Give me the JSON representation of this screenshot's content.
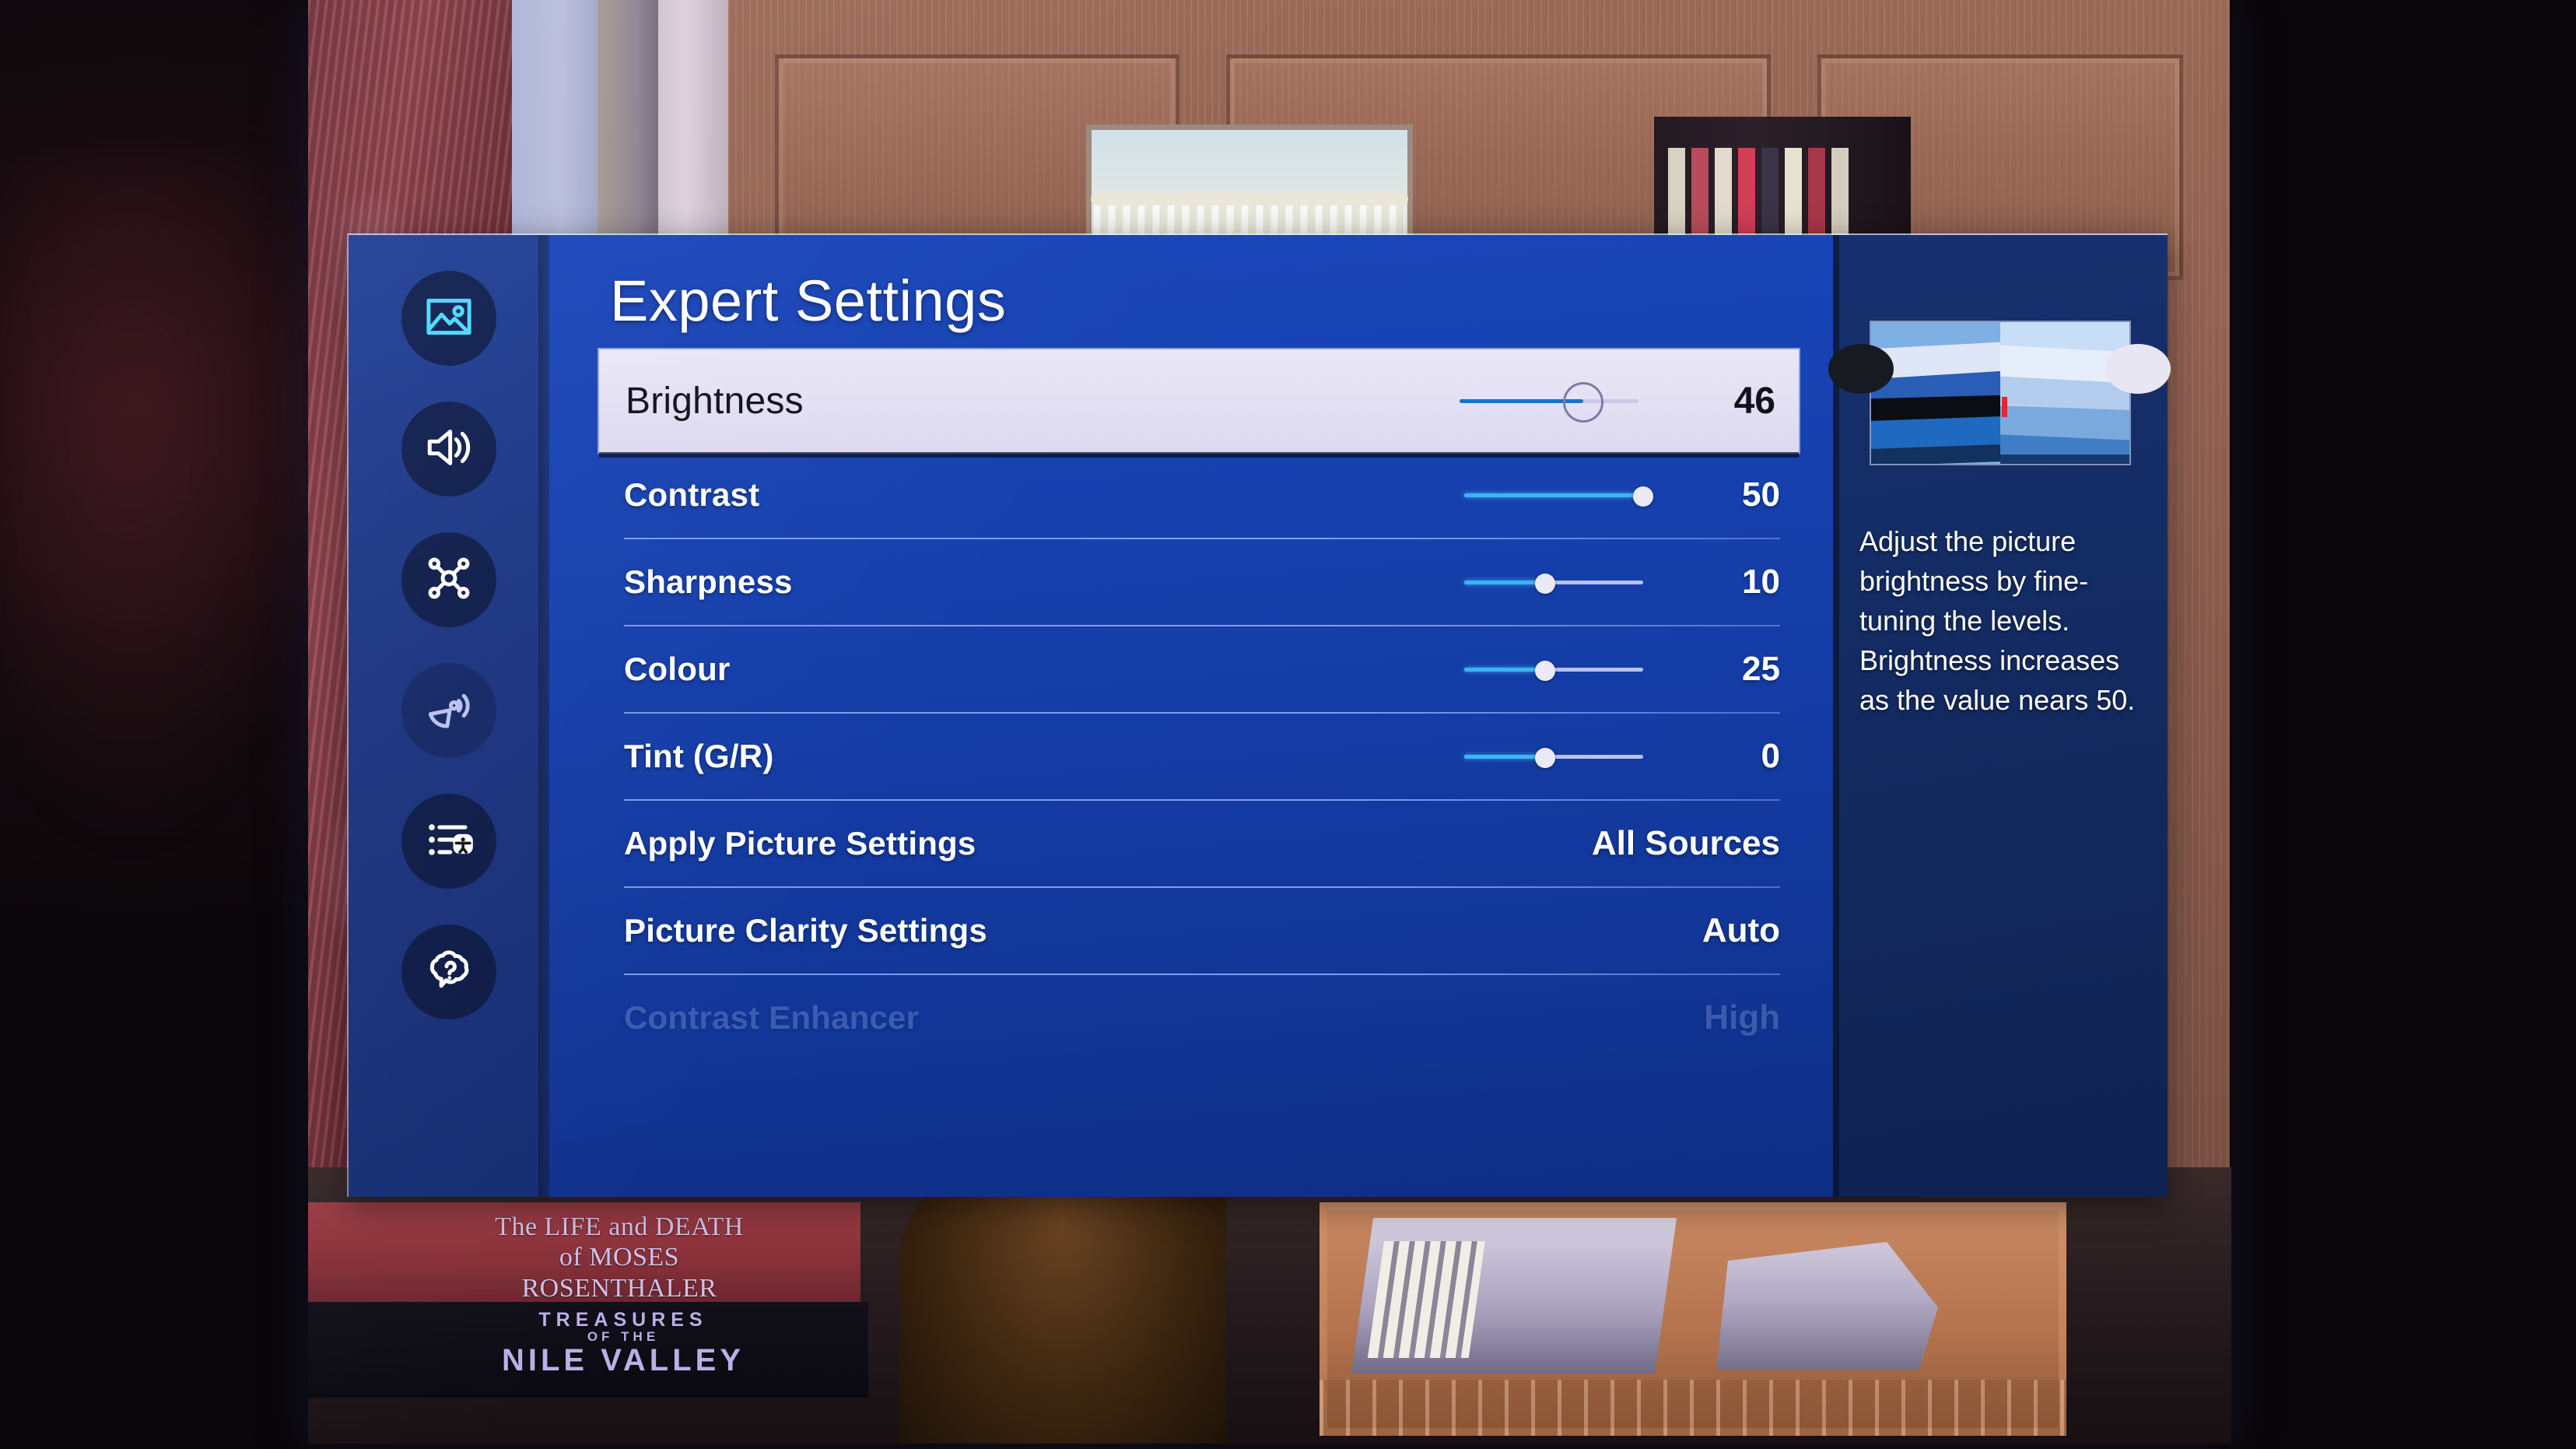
{
  "menu": {
    "title": "Expert Settings",
    "sidebar": [
      {
        "name": "picture",
        "icon": "picture-icon",
        "selected": true
      },
      {
        "name": "sound",
        "icon": "sound-icon",
        "selected": false
      },
      {
        "name": "connection",
        "icon": "connection-icon",
        "selected": false
      },
      {
        "name": "broadcasting",
        "icon": "broadcast-icon",
        "selected": false
      },
      {
        "name": "general-privacy",
        "icon": "accessibility-list-icon",
        "selected": false
      },
      {
        "name": "support",
        "icon": "help-bubble-icon",
        "selected": false
      }
    ],
    "rows": [
      {
        "label": "Brightness",
        "value": "46",
        "type": "slider",
        "fill_pct": 69,
        "focused": true
      },
      {
        "label": "Contrast",
        "value": "50",
        "type": "slider",
        "fill_pct": 100,
        "focused": false
      },
      {
        "label": "Sharpness",
        "value": "10",
        "type": "slider",
        "fill_pct": 45,
        "focused": false
      },
      {
        "label": "Colour",
        "value": "25",
        "type": "slider",
        "fill_pct": 45,
        "focused": false
      },
      {
        "label": "Tint (G/R)",
        "value": "0",
        "type": "slider",
        "fill_pct": 45,
        "focused": false
      },
      {
        "label": "Apply Picture Settings",
        "value": "All Sources",
        "type": "value",
        "focused": false
      },
      {
        "label": "Picture Clarity Settings",
        "value": "Auto",
        "type": "value",
        "focused": false
      },
      {
        "label": "Contrast Enhancer",
        "value": "High",
        "type": "value",
        "focused": false,
        "faded": true
      }
    ]
  },
  "info": {
    "description": "Adjust the picture brightness by fine-tuning the levels. Brightness increases as the value nears 50.",
    "preview_alt": "brightness-comparison-preview"
  },
  "background": {
    "book_top_line1": "The LIFE and DEATH",
    "book_top_line2": "of MOSES",
    "book_top_line3": "ROSENTHALER",
    "book_bottom_line1": "TREASURES",
    "book_bottom_line2": "OF THE",
    "book_bottom_line3": "NILE VALLEY"
  },
  "colors": {
    "menu_blue": "#1640ad",
    "rail_blue": "#1b3480",
    "info_blue": "#132a60",
    "accent_cyan": "#39b6f2",
    "focus_bg": "#e4e1f4",
    "focus_fill": "#1b72c9"
  }
}
